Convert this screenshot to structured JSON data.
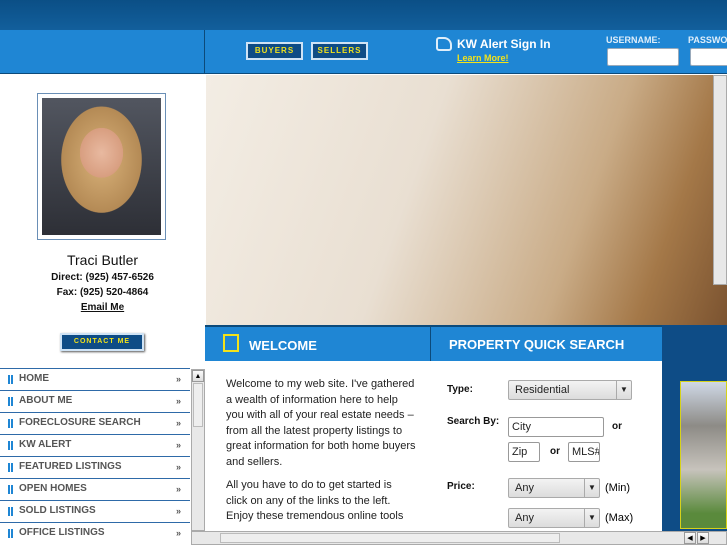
{
  "header": {
    "buyers": "BUYERS",
    "sellers": "SELLERS",
    "kw_alert": "KW Alert Sign In",
    "learn_more": "Learn More!",
    "username_label": "USERNAME:",
    "password_label": "PASSWORD:"
  },
  "agent": {
    "name": "Traci Butler",
    "direct": "Direct: (925) 457-6526",
    "fax": "Fax: (925) 520-4864",
    "email": "Email Me",
    "contact": "CONTACT ME"
  },
  "menu": [
    {
      "label": "HOME"
    },
    {
      "label": "ABOUT ME"
    },
    {
      "label": "FORECLOSURE SEARCH"
    },
    {
      "label": "KW ALERT"
    },
    {
      "label": "FEATURED LISTINGS"
    },
    {
      "label": "OPEN HOMES"
    },
    {
      "label": "SOLD LISTINGS"
    },
    {
      "label": "OFFICE LISTINGS"
    }
  ],
  "menu_arrow": "»",
  "welcome": {
    "title": "WELCOME",
    "p1": "Welcome to my web site. I've gathered a wealth of information here to help you with all of your real estate needs – from all the latest property listings to great information for both home buyers and sellers.",
    "p2": "All you have to do to get started is click on any of the links to the left. Enjoy these tremendous online tools"
  },
  "search": {
    "title": "PROPERTY QUICK SEARCH",
    "type_label": "Type:",
    "type_value": "Residential",
    "search_by_label": "Search By:",
    "city": "City",
    "or": "or",
    "zip": "Zip",
    "mls": "MLS#",
    "price_label": "Price:",
    "min_value": "Any",
    "min_label": "(Min)",
    "max_value": "Any",
    "max_label": "(Max)"
  }
}
